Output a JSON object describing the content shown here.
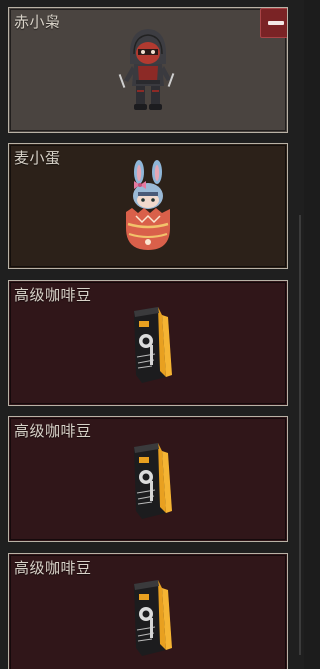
{
  "colors": {
    "page_bg": "#1f1f1f",
    "card_border": "#b9b2a6",
    "title_text": "#d8d2c8",
    "remove_button": "#7a2325",
    "character_bg": "#4a4440",
    "pet_bg": "#2c2119",
    "item_bg": "#301619"
  },
  "items": [
    {
      "title": "赤小枭",
      "kind": "character",
      "image": "hooded-ninja-character-icon"
    },
    {
      "title": "麦小蛋",
      "kind": "pet",
      "image": "bunny-egg-pet-icon"
    },
    {
      "title": "高级咖啡豆",
      "kind": "item",
      "image": "coffee-bean-bag-icon"
    },
    {
      "title": "高级咖啡豆",
      "kind": "item",
      "image": "coffee-bean-bag-icon"
    },
    {
      "title": "高级咖啡豆",
      "kind": "item",
      "image": "coffee-bean-bag-icon"
    }
  ],
  "remove_button": {
    "icon": "minus-icon"
  }
}
